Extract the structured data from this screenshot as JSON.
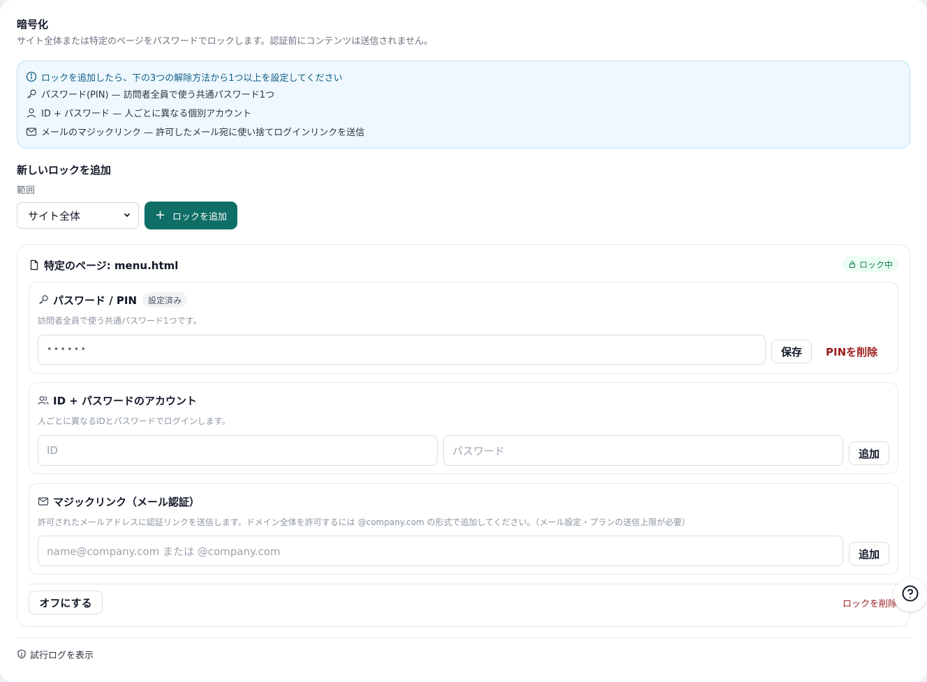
{
  "encryption": {
    "title": "暗号化",
    "description": "サイト全体または特定のページをパスワードでロックします。認証前にコンテンツは送信されません。"
  },
  "info": {
    "heading": "ロックを追加したら、下の3つの解除方法から1つ以上を設定してください",
    "items": [
      {
        "icon": "key-icon",
        "text": "パスワード(PIN) — 訪問者全員で使う共通パスワード1つ"
      },
      {
        "icon": "user-icon",
        "text": "ID + パスワード — 人ごとに異なる個別アカウント"
      },
      {
        "icon": "mail-icon",
        "text": "メールのマジックリンク — 許可したメール宛に使い捨てログインリンクを送信"
      }
    ]
  },
  "add_lock": {
    "title": "新しいロックを追加",
    "scope_label": "範囲",
    "scope_value": "サイト全体",
    "add_button": "ロックを追加"
  },
  "lock": {
    "title": "特定のページ: menu.html",
    "badge": "ロック中",
    "pin": {
      "title": "パスワード / PIN",
      "chip": "設定済み",
      "description": "訪問者全員で使う共通パスワード1つです。",
      "value": "••••••",
      "save": "保存",
      "delete": "PINを削除"
    },
    "accounts": {
      "title": "ID + パスワードのアカウント",
      "description": "人ごとに異なるIDとパスワードでログインします。",
      "id_placeholder": "ID",
      "password_placeholder": "パスワード",
      "add": "追加"
    },
    "magic": {
      "title": "マジックリンク（メール認証）",
      "description": "許可されたメールアドレスに認証リンクを送信します。ドメイン全体を許可するには @company.com の形式で追加してください。（メール設定・プランの送信上限が必要）",
      "placeholder": "name@company.com または @company.com",
      "add": "追加"
    },
    "off_button": "オフにする",
    "remove": "ロックを削除"
  },
  "footer": {
    "log_link": "試行ログを表示"
  },
  "colors": {
    "accent": "#0f6e66",
    "danger": "#9b1c1c",
    "info_bg": "#eff8fe",
    "locked_badge": "#0f7a52"
  }
}
